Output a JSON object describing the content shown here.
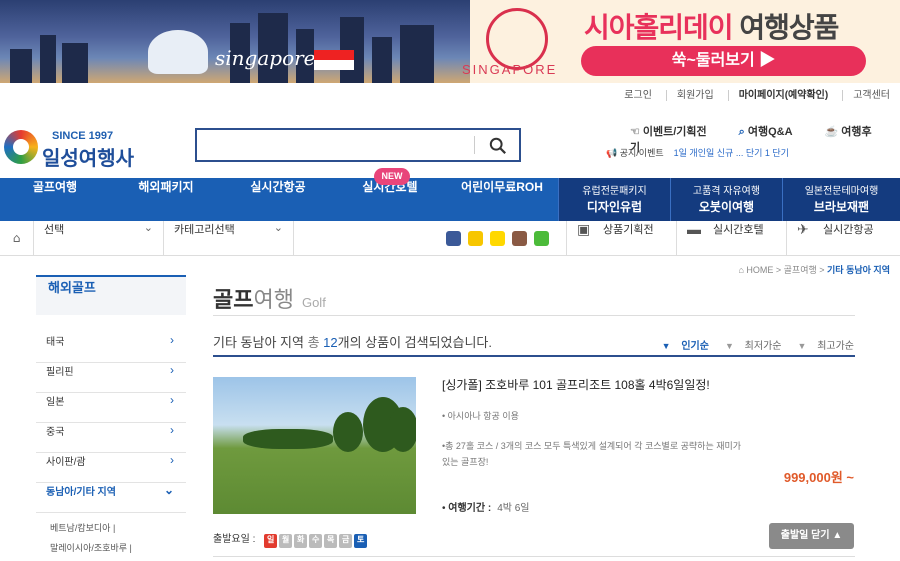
{
  "banner": {
    "city_text": "singapore",
    "badge_text": "SINGAPORE",
    "title_accent": "시아홀리데이",
    "title_rest": "여행상품",
    "button_label": "쑥~둘러보기 ▶"
  },
  "util_links": [
    "로그인",
    "회원가입",
    "마이페이지(예약확인)",
    "고객센터"
  ],
  "logo": {
    "since": "SINCE 1997",
    "name": "일성여행사"
  },
  "search": {
    "value": "",
    "placeholder": ""
  },
  "quick_links": [
    "이벤트/기획전",
    "여행Q&A",
    "여행후기"
  ],
  "notice": {
    "label": "공지/이벤트",
    "ticker": "1일 개인일 신규 ... 단기 1 단기"
  },
  "gnb": {
    "items": [
      "골프여행",
      "해외패키지",
      "실시간항공",
      "실시간호텔",
      "어린이무료ROH"
    ],
    "new_badge": "NEW",
    "dark_items": [
      {
        "top": "유럽전문패키지",
        "bottom": "디자인유럽"
      },
      {
        "top": "고품격 자유여행",
        "bottom": "오붓이여행"
      },
      {
        "top": "일본전문테마여행",
        "bottom": "브라보재팬"
      }
    ]
  },
  "subbar": {
    "select1": "선택",
    "select2": "카테고리선택",
    "links": [
      "상품기획전",
      "실시간호텔",
      "실시간항공"
    ]
  },
  "breadcrumb": {
    "home": "HOME",
    "mid": "골프여행",
    "current": "기타 동남아 지역"
  },
  "lnb": {
    "title": "해외골프",
    "items": [
      "태국",
      "필리핀",
      "일본",
      "중국",
      "사이판/괌",
      "동남아/기타 지역"
    ],
    "subitems": [
      "베트남/캄보디아 |",
      "말레이시아/조호바루 |"
    ]
  },
  "page": {
    "title_strong": "골프",
    "title_light": "여행",
    "title_en": "Golf"
  },
  "results": {
    "region": "기타 동남아 지역",
    "pre": "총",
    "count": "12",
    "post": "개의 상품이 검색되었습니다."
  },
  "sorts": [
    "인기순",
    "최저가순",
    "최고가순"
  ],
  "product": {
    "title": "[싱가폴] 조호바루 101 골프리조트 108홀 4박6일일정!",
    "desc1": "• 아시아나 항공 이용",
    "desc2": "•총 27홀 코스 / 3개의 코스 모두 특색있게 설계되어 각 코스별로 공략하는 재미가 있는 골프장!",
    "price": "999,000원 ~",
    "period_label": "여행기간 :",
    "period_value": "4박 6일",
    "days_label": "출발요일 :",
    "days": [
      "일",
      "월",
      "화",
      "수",
      "목",
      "금",
      "토"
    ],
    "departure_button": "출발일 닫기 ▲"
  },
  "colors": {
    "brand": "#1a5fb4",
    "accent": "#e8305a",
    "price": "#e05a2a"
  }
}
